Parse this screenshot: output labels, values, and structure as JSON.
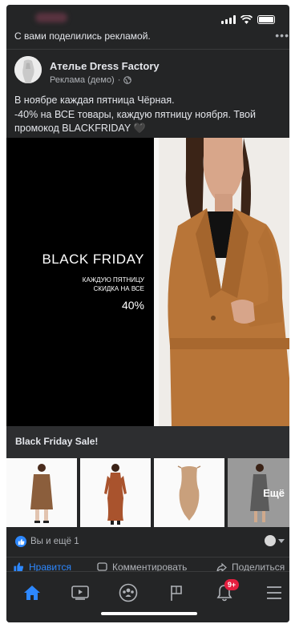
{
  "status_bar": {
    "signal": "signal-icon",
    "wifi": "wifi-icon",
    "battery": "battery-icon"
  },
  "post": {
    "shared_notice": "С вами поделились рекламой.",
    "page_name": "Ателье Dress Factory",
    "sponsored_label": "Реклама (демо)",
    "text_line_1": "В ноябре каждая пятница Чёрная.",
    "text_line_2": "-40% на ВСЕ товары, каждую пятницу ноября. Твой",
    "text_line_3": "промокод BLACKFRIDAY 🖤",
    "hero": {
      "title": "BLACK FRIDAY",
      "subtitle_1": "КАЖДУЮ ПЯТНИЦУ",
      "subtitle_2": "СКИДКА НА ВСЕ",
      "percent": "40%"
    },
    "caption": "Black Friday Sale!",
    "carousel": {
      "items": [
        "coat-product",
        "dress-product",
        "bodysuit-product",
        "more-product"
      ],
      "more_label": "Ещё"
    },
    "reactions": {
      "text": "Вы и ещё 1"
    },
    "actions": {
      "like": "Нравится",
      "comment": "Комментировать",
      "share": "Поделиться"
    }
  },
  "tab_bar": {
    "tabs": [
      "home-icon",
      "video-icon",
      "groups-icon",
      "flag-icon",
      "bell-icon",
      "menu-icon"
    ],
    "notifications_badge": "9+"
  },
  "colors": {
    "background": "#242526",
    "accent": "#2d88ff",
    "badge": "#e41e3f",
    "coat": "#b87333"
  }
}
